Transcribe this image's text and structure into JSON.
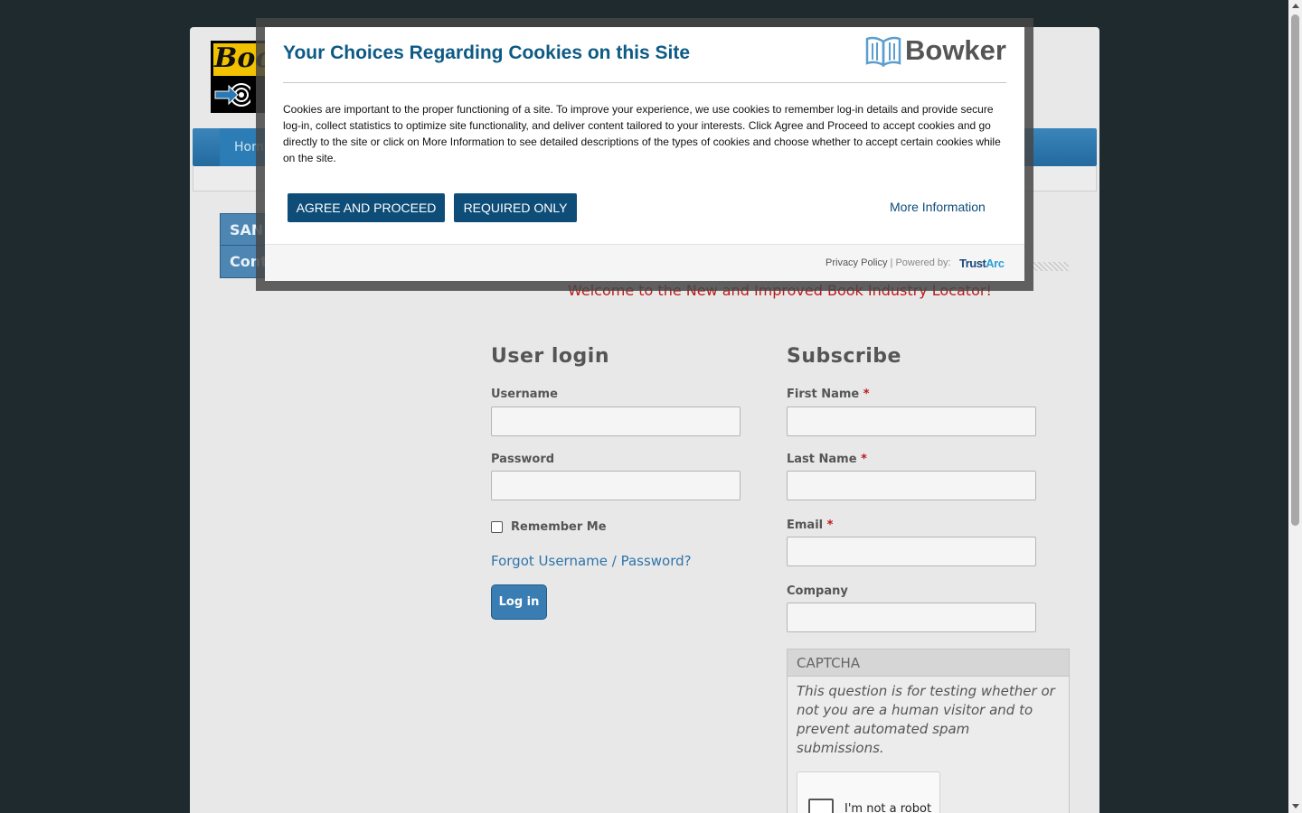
{
  "logo": {
    "text": "Boo"
  },
  "nav": {
    "home_label": "Hom"
  },
  "sidebar": {
    "items": [
      {
        "label": "SAN"
      },
      {
        "label": "Cont"
      }
    ]
  },
  "welcome": "Welcome to the New and Improved Book Industry Locator!",
  "login": {
    "title": "User login",
    "username_label": "Username",
    "username_value": "",
    "password_label": "Password",
    "password_value": "",
    "remember_label": "Remember Me",
    "remember_checked": false,
    "forgot_link": "Forgot Username / Password?",
    "submit_label": "Log in"
  },
  "subscribe": {
    "title": "Subscribe",
    "required_marker": "*",
    "first_name_label": "First Name",
    "first_name_value": "",
    "last_name_label": "Last Name",
    "last_name_value": "",
    "email_label": "Email",
    "email_value": "",
    "company_label": "Company",
    "company_value": "",
    "captcha": {
      "legend": "CAPTCHA",
      "description": "This question is for testing whether or not you are a human visitor and to prevent automated spam submissions.",
      "recaptcha_label": "I'm not a robot"
    }
  },
  "cookie_modal": {
    "title": "Your Choices Regarding Cookies on this Site",
    "brand": "Bowker",
    "body": "Cookies are important to the proper functioning of a site. To improve your experience, we use cookies to remember log-in details and provide secure log-in, collect statistics to optimize site functionality, and deliver content tailored to your interests. Click Agree and Proceed to accept cookies and go directly to the site or click on More Information to see detailed descriptions of the types of cookies and choose whether to accept certain cookies while on the site.",
    "agree_button": "AGREE AND PROCEED",
    "required_button": "REQUIRED ONLY",
    "more_info_link": "More Information",
    "privacy_link": "Privacy Policy",
    "footer_separator": " | Powered by: ",
    "powered_by_trust": "Trust",
    "powered_by_arc": "Arc"
  },
  "colors": {
    "modal_title": "#0d5a85",
    "modal_button": "#0d4d78",
    "nav_blue": "#2c7cb6",
    "welcome_red": "#c01818",
    "link_blue": "#2f74a9",
    "page_bg": "#1e2a2d"
  }
}
